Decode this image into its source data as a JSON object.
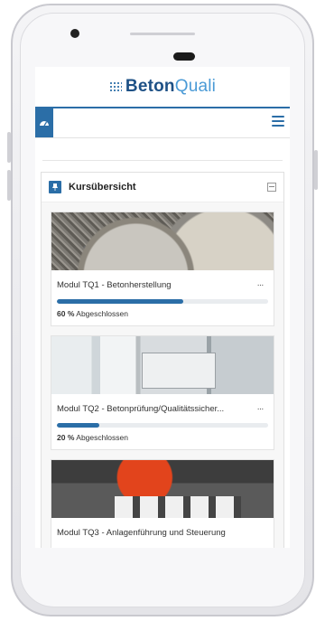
{
  "brand": {
    "part1": "Beton",
    "part2": "Quali"
  },
  "block": {
    "title": "Kursübersicht"
  },
  "courses": [
    {
      "title": "Modul TQ1 - Betonherstellung",
      "percent": 60,
      "percent_text": "60 %",
      "status": "Abgeschlossen",
      "menu": "···"
    },
    {
      "title": "Modul TQ2 - Betonprüfung/Qualitätssicher...",
      "percent": 20,
      "percent_text": "20 %",
      "status": "Abgeschlossen",
      "menu": "···"
    },
    {
      "title": "Modul TQ3 - Anlagenführung und Steuerung"
    }
  ],
  "colors": {
    "accent": "#2b6ea7"
  },
  "icons": {
    "dashboard": "dashboard-icon",
    "menu": "hamburger-icon",
    "block": "pin-icon",
    "collapse": "collapse-icon",
    "card_menu": "more-icon"
  }
}
